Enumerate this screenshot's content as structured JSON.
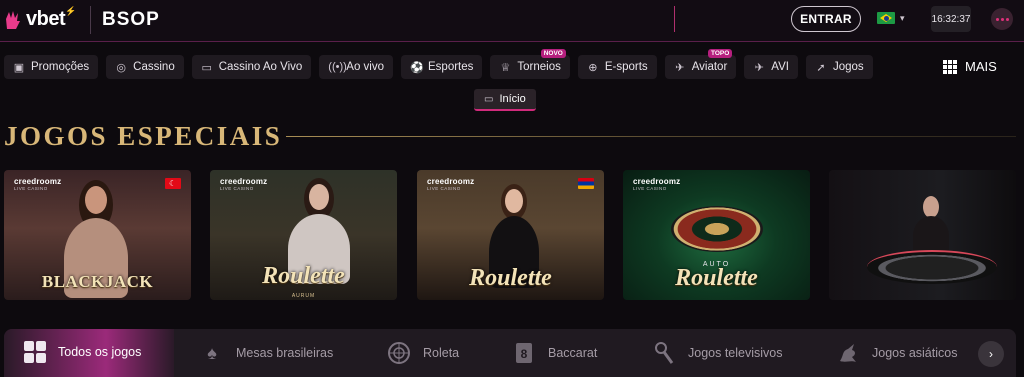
{
  "header": {
    "logo_text": "vbet",
    "logo_sup": "⚡",
    "partner": "BSOP",
    "login_label": "ENTRAR",
    "clock": "16:32:37",
    "language_flag": "brazil-flag"
  },
  "nav": {
    "items": [
      {
        "label": "Promoções",
        "icon": "gift-icon"
      },
      {
        "label": "Cassino",
        "icon": "casino-chip-icon"
      },
      {
        "label": "Cassino Ao Vivo",
        "icon": "video-camera-icon"
      },
      {
        "label": "Ao vivo",
        "icon": "live-broadcast-icon"
      },
      {
        "label": "Esportes",
        "icon": "soccer-ball-icon"
      },
      {
        "label": "Torneios",
        "icon": "trophy-icon",
        "badge": "NOVO"
      },
      {
        "label": "E-sports",
        "icon": "gamepad-icon"
      },
      {
        "label": "Aviator",
        "icon": "airplane-icon",
        "badge": "TOPO"
      },
      {
        "label": "AVI",
        "icon": "plane-icon"
      },
      {
        "label": "Jogos",
        "icon": "rocket-icon"
      }
    ],
    "more_label": "MAIS"
  },
  "subnav": {
    "active_label": "Início"
  },
  "section": {
    "title": "JOGOS ESPECIAIS"
  },
  "games": [
    {
      "provider": "creedroomz",
      "provider_sub": "LIVE CASINO",
      "title": "BLACKJACK",
      "subtitle": "",
      "flag": "turkey-flag"
    },
    {
      "provider": "creedroomz",
      "provider_sub": "LIVE CASINO",
      "title": "Roulette",
      "subtitle": "AURUM",
      "flag": ""
    },
    {
      "provider": "creedroomz",
      "provider_sub": "LIVE CASINO",
      "title": "Roulette",
      "subtitle": "",
      "flag": "armenia-flag"
    },
    {
      "provider": "creedroomz",
      "provider_sub": "LIVE CASINO",
      "title": "Roulette",
      "subtitle": "AUTO",
      "flag": ""
    },
    {
      "provider": "",
      "provider_sub": "",
      "title": "",
      "subtitle": "",
      "flag": ""
    }
  ],
  "categories": [
    {
      "label": "Todos os jogos",
      "icon": "tiles-icon",
      "active": true
    },
    {
      "label": "Mesas brasileiras",
      "icon": "spade-icon",
      "active": false
    },
    {
      "label": "Roleta",
      "icon": "roulette-wheel-icon",
      "active": false
    },
    {
      "label": "Baccarat",
      "icon": "card-8-icon",
      "active": false
    },
    {
      "label": "Jogos televisivos",
      "icon": "microphone-icon",
      "active": false
    },
    {
      "label": "Jogos asiáticos",
      "icon": "dragon-icon",
      "active": false
    }
  ],
  "colors": {
    "accent": "#d12b7c",
    "gold": "#d8b778",
    "background": "#0d0a0e"
  }
}
